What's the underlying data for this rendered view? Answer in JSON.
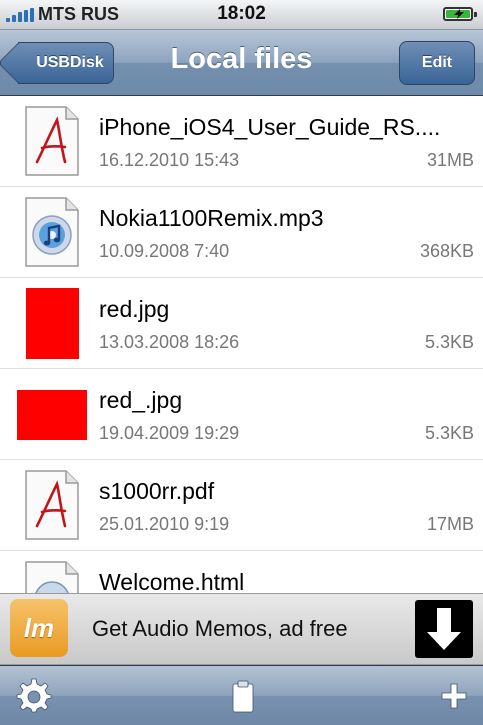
{
  "status_bar": {
    "carrier": "MTS RUS",
    "time": "18:02"
  },
  "nav": {
    "back_label": "USBDisk",
    "title": "Local files",
    "edit_label": "Edit"
  },
  "files": [
    {
      "name": "iPhone_iOS4_User_Guide_RS....",
      "date": "16.12.2010 15:43",
      "size": "31MB",
      "icon": "pdf-document-icon"
    },
    {
      "name": "Nokia1100Remix.mp3",
      "date": "10.09.2008 7:40",
      "size": "368KB",
      "icon": "itunes-music-icon"
    },
    {
      "name": "red.jpg",
      "date": "13.03.2008 18:26",
      "size": "5.3KB",
      "icon": "image-thumbnail"
    },
    {
      "name": "red_.jpg",
      "date": "19.04.2009 19:29",
      "size": "5.3KB",
      "icon": "image-thumbnail"
    },
    {
      "name": "s1000rr.pdf",
      "date": "25.01.2010 9:19",
      "size": "17MB",
      "icon": "pdf-document-icon"
    },
    {
      "name": "Welcome.html",
      "date": "",
      "size": "",
      "icon": "safari-document-icon"
    }
  ],
  "banner": {
    "logo_text": "lm",
    "text": "Get Audio Memos, ad free"
  },
  "colors": {
    "nav_bar": "#7f98b5",
    "thumbnail_red": "#ff0000",
    "pdf_glyph_red": "#c0161b"
  }
}
